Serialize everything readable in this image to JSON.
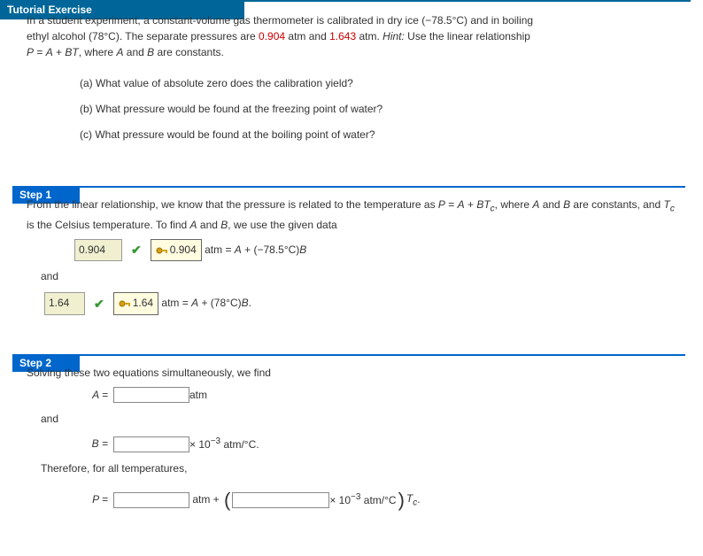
{
  "headers": {
    "tutorial": "Tutorial Exercise",
    "step1": "Step 1",
    "step2": "Step 2"
  },
  "problem": {
    "line1a": "In a student experiment, a constant-volume gas thermometer is calibrated in dry ice (−78.5°C) and in boiling",
    "line2a": "ethyl alcohol (78°C). The separate pressures are ",
    "p1": "0.904",
    "mid": " atm and ",
    "p2": "1.643",
    "line2b": " atm. ",
    "hint_label": "Hint:",
    "hint_text": " Use the linear relationship",
    "line3": "P = A + BT, where A and B are constants.",
    "qa": "(a) What value of absolute zero does the calibration yield?",
    "qb": "(b) What pressure would be found at the freezing point of water?",
    "qc": "(c) What pressure would be found at the boiling point of water?"
  },
  "step1": {
    "text": "From the linear relationship, we know that the pressure is related to the temperature as P = A + BT_c, where A and B are constants, and T_c is the Celsius temperature. To find A and B, we use the given data",
    "eq1": {
      "input": "0.904",
      "sol": "0.904",
      "rest": " atm = A + (−78.5°C)B"
    },
    "and": "and",
    "eq2": {
      "input": "1.64",
      "sol": "1.64",
      "rest": " atm = A + (78°C)B."
    }
  },
  "step2": {
    "intro": "Solving these two equations simultaneously, we find",
    "rowA": {
      "label": "A =",
      "unit": " atm"
    },
    "and": "and",
    "rowB": {
      "label": "B =",
      "unit_pre": " × 10",
      "unit_exp": "−3",
      "unit_post": " atm/°C."
    },
    "therefore": "Therefore, for all temperatures,",
    "rowP": {
      "label": "P =",
      "mid": " atm + ",
      "unit_pre": " × 10",
      "unit_exp": "−3",
      "unit_post": " atm/°C",
      "tail_var": "T",
      "tail_sub": "c",
      "tail_end": "."
    }
  }
}
